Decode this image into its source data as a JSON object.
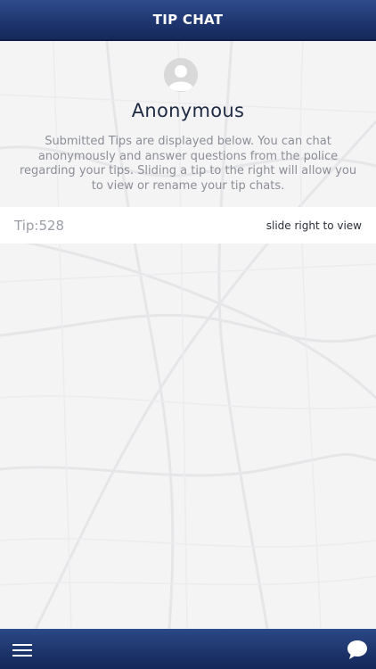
{
  "header": {
    "title": "TIP CHAT"
  },
  "profile": {
    "name": "Anonymous",
    "instructions": "Submitted Tips are displayed below. You can chat anonymously and answer questions from the police regarding your tips. Sliding a tip to the right will allow you to view or rename your tip chats."
  },
  "tips": [
    {
      "label": "Tip:528",
      "hint": "slide right to view"
    }
  ],
  "footer": {
    "left_icon": "hamburger-menu-icon",
    "right_icon": "chat-bubble-icon"
  },
  "colors": {
    "header_bg": "#1f3670",
    "footer_bg": "#1c3369",
    "title_text": "#1f2a44",
    "body_text": "#8c8f96"
  }
}
